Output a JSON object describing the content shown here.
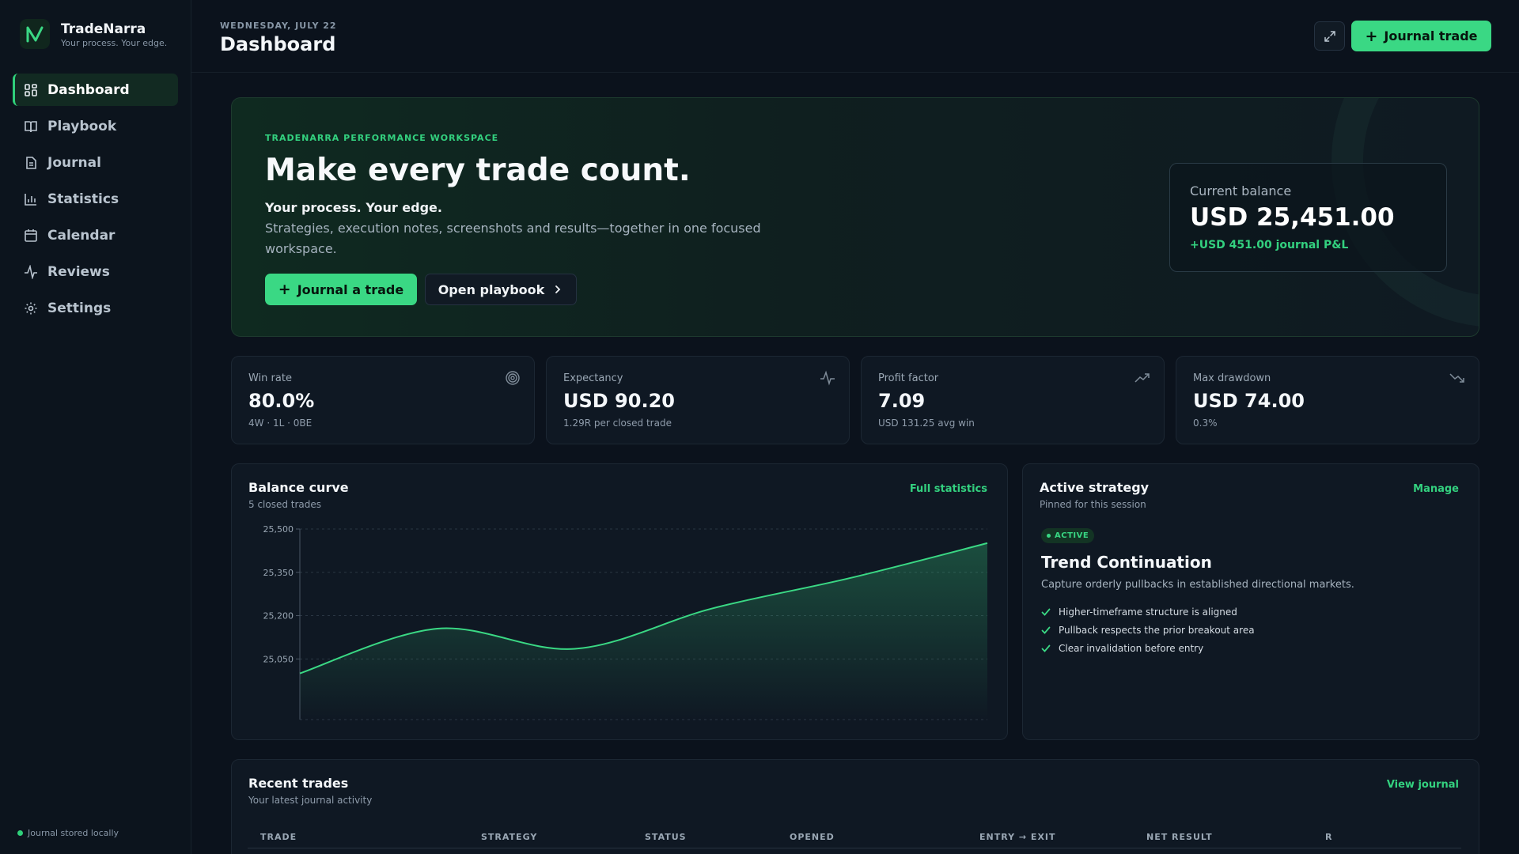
{
  "brand": {
    "name": "TradeNarra",
    "tagline": "Your process. Your edge."
  },
  "nav": [
    {
      "label": "Dashboard",
      "icon": "grid-icon",
      "active": true
    },
    {
      "label": "Playbook",
      "icon": "book-icon"
    },
    {
      "label": "Journal",
      "icon": "file-text-icon"
    },
    {
      "label": "Statistics",
      "icon": "bar-chart-icon"
    },
    {
      "label": "Calendar",
      "icon": "calendar-icon"
    },
    {
      "label": "Reviews",
      "icon": "activity-icon"
    },
    {
      "label": "Settings",
      "icon": "gear-icon"
    }
  ],
  "sidebar_footer": "Journal stored locally",
  "header": {
    "date": "WEDNESDAY, JULY 22",
    "title": "Dashboard",
    "primary_button": "Journal trade"
  },
  "hero": {
    "eyebrow": "TRADENARRA PERFORMANCE WORKSPACE",
    "title": "Make every trade count.",
    "subtitle": "Your process. Your edge.",
    "description": "Strategies, execution notes, screenshots and results—together in one focused workspace.",
    "cta_primary": "Journal a trade",
    "cta_secondary": "Open playbook",
    "balance_label": "Current balance",
    "balance_value": "USD 25,451.00",
    "balance_pnl": "+USD 451.00 journal P&L"
  },
  "stats": [
    {
      "label": "Win rate",
      "value": "80.0%",
      "sub": "4W · 1L · 0BE",
      "icon": "target-icon"
    },
    {
      "label": "Expectancy",
      "value": "USD 90.20",
      "sub": "1.29R per closed trade",
      "icon": "pulse-icon"
    },
    {
      "label": "Profit factor",
      "value": "7.09",
      "sub": "USD 131.25 avg win",
      "icon": "trending-up-icon"
    },
    {
      "label": "Max drawdown",
      "value": "USD 74.00",
      "sub": "0.3%",
      "icon": "trending-down-icon"
    }
  ],
  "balance_curve": {
    "title": "Balance curve",
    "subtitle": "5 closed trades",
    "link": "Full statistics",
    "ticks": [
      "25,500",
      "25,350",
      "25,200",
      "25,050"
    ]
  },
  "chart_data": {
    "type": "area",
    "title": "Balance curve",
    "x": [
      0,
      1,
      2,
      3,
      4,
      5
    ],
    "y": [
      25000,
      25155,
      25085,
      25225,
      25330,
      25451
    ],
    "ylim": [
      24840,
      25500
    ],
    "yticks": [
      25050,
      25200,
      25350,
      25500
    ],
    "grid": true,
    "color": "#3ad884"
  },
  "strategy": {
    "title": "Active strategy",
    "subtitle": "Pinned for this session",
    "link": "Manage",
    "badge": "ACTIVE",
    "name": "Trend Continuation",
    "description": "Capture orderly pullbacks in established directional markets.",
    "rules": [
      "Higher-timeframe structure is aligned",
      "Pullback respects the prior breakout area",
      "Clear invalidation before entry"
    ]
  },
  "recent": {
    "title": "Recent trades",
    "subtitle": "Your latest journal activity",
    "link": "View journal",
    "columns": [
      "TRADE",
      "STRATEGY",
      "STATUS",
      "OPENED",
      "ENTRY → EXIT",
      "NET RESULT",
      "R"
    ]
  },
  "colors": {
    "accent": "#3ad884",
    "background": "#0b121c",
    "card": "#0f1823"
  }
}
